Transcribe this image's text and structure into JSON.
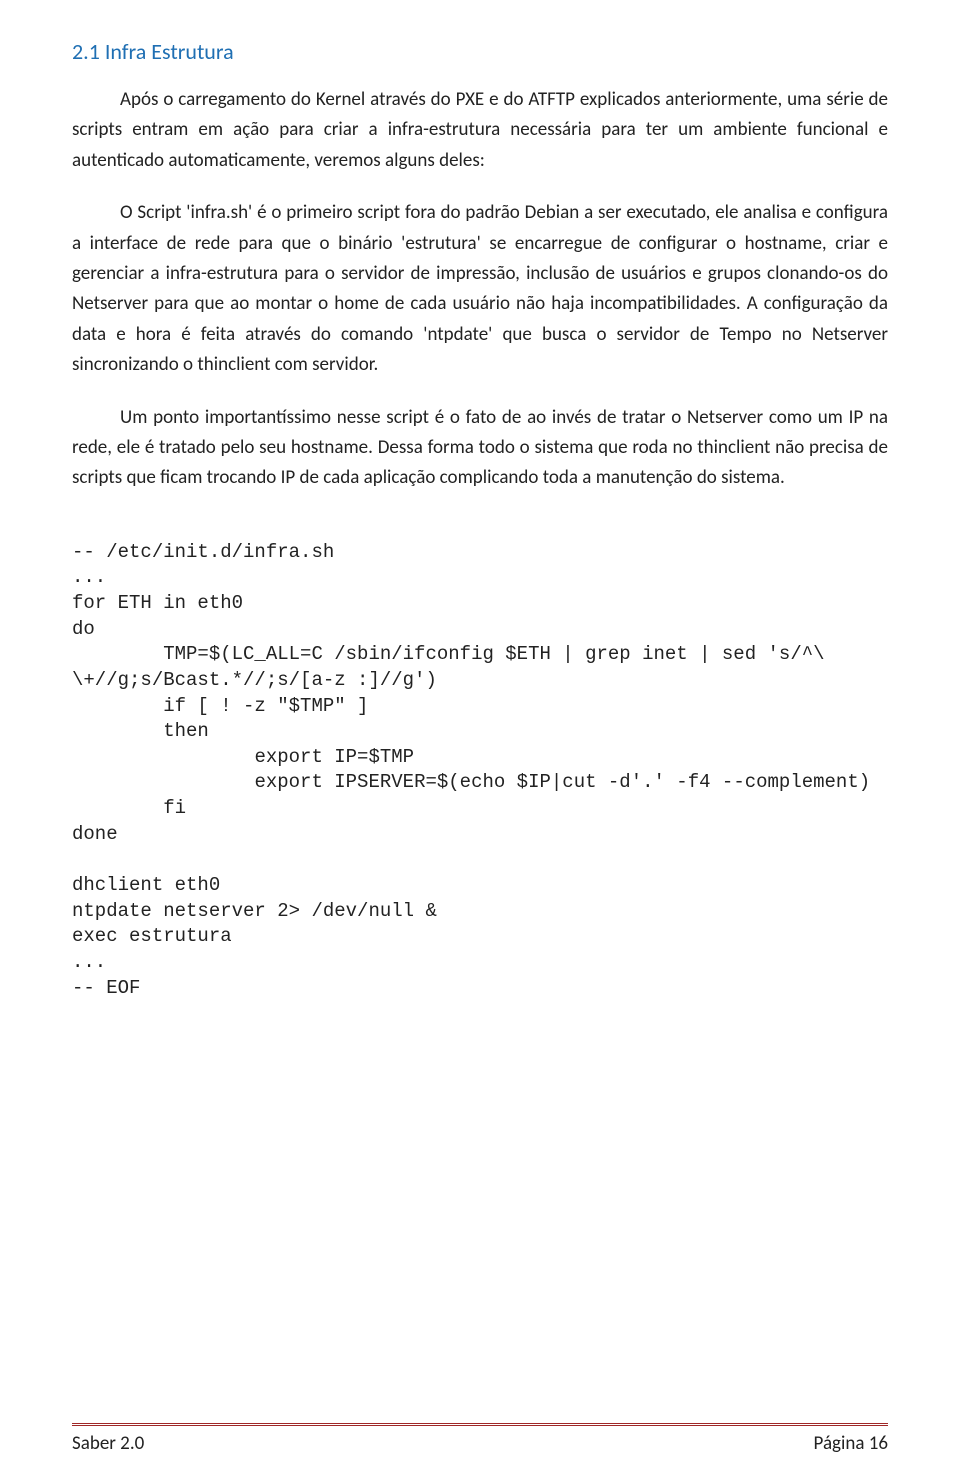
{
  "section": {
    "heading": "2.1 Infra Estrutura"
  },
  "paragraphs": {
    "p1": "Após o carregamento do Kernel através do PXE e do ATFTP explicados anteriormente, uma série de scripts entram em ação para criar a infra-estrutura necessária para ter um ambiente funcional e autenticado automaticamente, veremos alguns deles:",
    "p2": "O Script 'infra.sh' é o primeiro script fora do padrão Debian a ser executado, ele analisa e configura a interface de rede para que o binário 'estrutura' se encarregue de configurar o hostname, criar e gerenciar a infra-estrutura para o servidor de impressão, inclusão de usuários e grupos clonando-os do Netserver para que ao montar o home de cada usuário não haja incompatibilidades. A configuração da data e hora é feita através do comando 'ntpdate' que busca o servidor de Tempo no Netserver sincronizando o thinclient com servidor.",
    "p3": "Um ponto importantíssimo nesse script é o fato de ao invés de tratar o Netserver como um IP na rede, ele é tratado pelo seu hostname. Dessa forma todo o sistema que roda no thinclient não precisa de scripts que ficam trocando IP de cada aplicação complicando toda a manutenção do sistema."
  },
  "code": "-- /etc/init.d/infra.sh\n...\nfor ETH in eth0\ndo\n        TMP=$(LC_ALL=C /sbin/ifconfig $ETH | grep inet | sed 's/^\\\n\\+//g;s/Bcast.*//;s/[a-z :]//g')\n        if [ ! -z \"$TMP\" ]\n        then\n                export IP=$TMP\n                export IPSERVER=$(echo $IP|cut -d'.' -f4 --complement)\n        fi\ndone\n\ndhclient eth0\nntpdate netserver 2> /dev/null &\nexec estrutura\n...\n-- EOF",
  "footer": {
    "left": "Saber 2.0",
    "right": "Página 16"
  }
}
